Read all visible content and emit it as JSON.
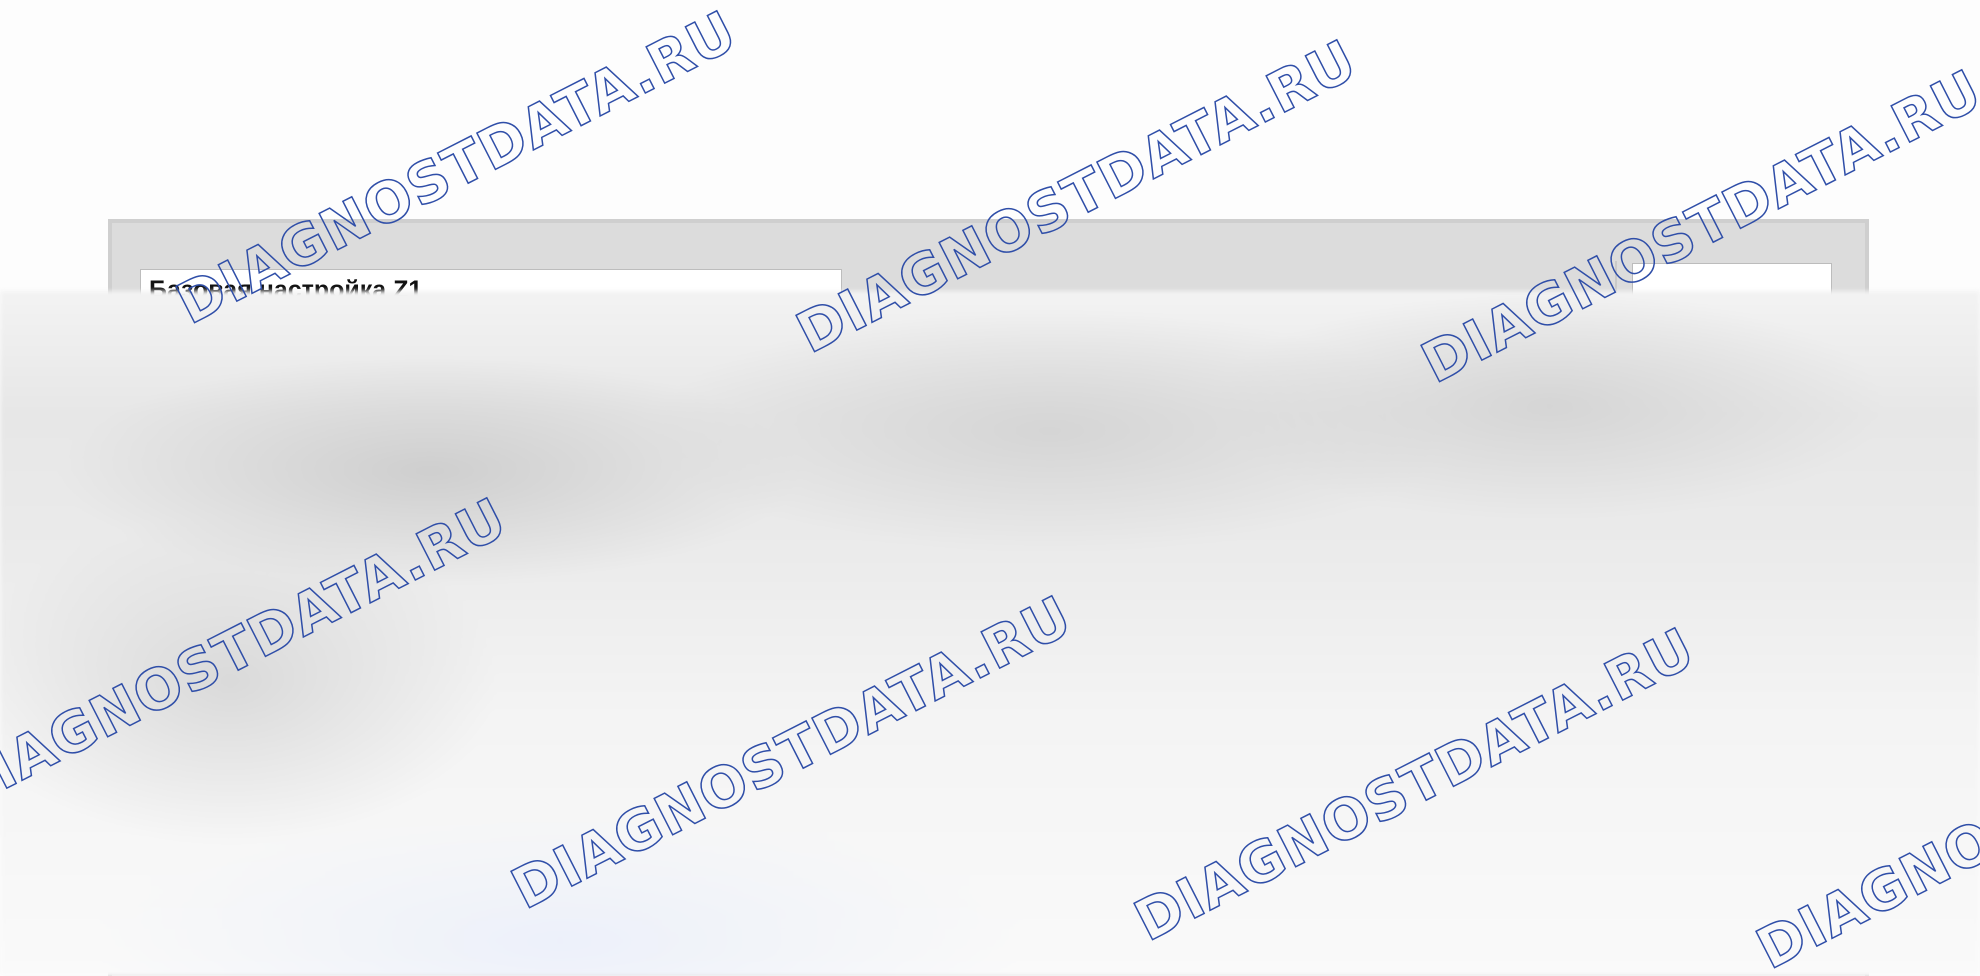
{
  "dialog": {
    "title_field_value": "Базовая настройка Z1"
  },
  "watermark": {
    "text": "DIAGNOSTDATA.RU",
    "color": "#2f4ea8"
  }
}
